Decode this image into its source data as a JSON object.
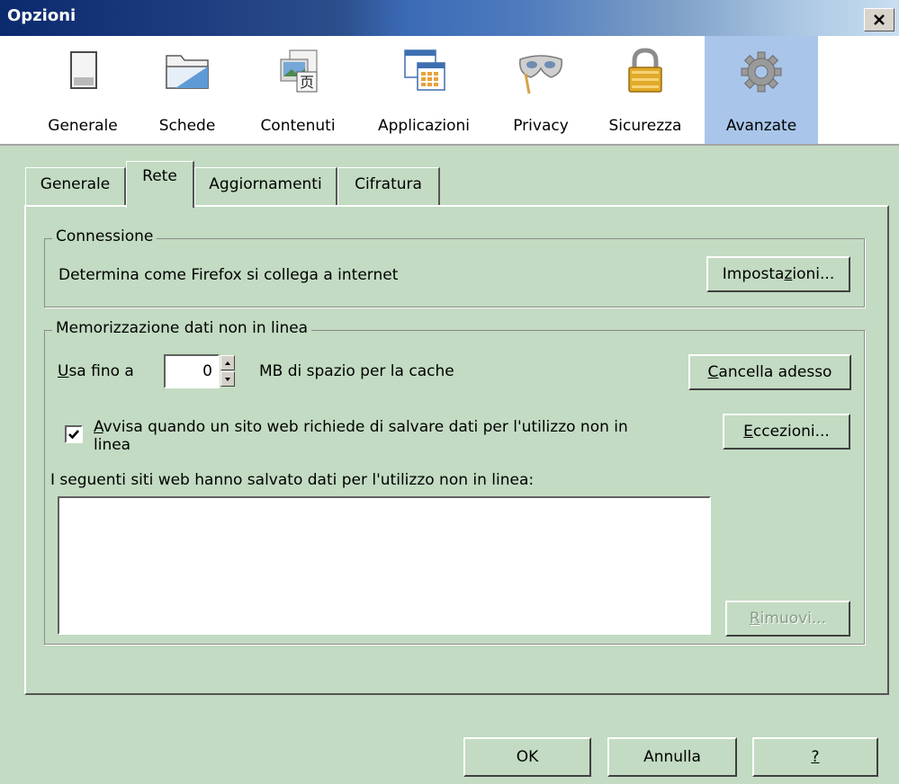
{
  "window": {
    "title": "Opzioni",
    "close_glyph": "✕"
  },
  "toolbar": {
    "items": [
      {
        "label": "Generale",
        "icon": "window-icon"
      },
      {
        "label": "Schede",
        "icon": "tabs-icon"
      },
      {
        "label": "Contenuti",
        "icon": "content-icon"
      },
      {
        "label": "Applicazioni",
        "icon": "applications-icon"
      },
      {
        "label": "Privacy",
        "icon": "privacy-mask-icon"
      },
      {
        "label": "Sicurezza",
        "icon": "lock-icon"
      },
      {
        "label": "Avanzate",
        "icon": "gear-icon"
      }
    ],
    "active_index": 6
  },
  "tabs": [
    {
      "label": "Generale"
    },
    {
      "label": "Rete"
    },
    {
      "label": "Aggiornamenti"
    },
    {
      "label": "Cifratura"
    }
  ],
  "active_tab": "Rete",
  "connection": {
    "title": "Connessione",
    "description": "Determina come Firefox si collega a internet",
    "settings_button": {
      "before": "Imposta",
      "mnemonic": "z",
      "after": "ioni..."
    }
  },
  "offline": {
    "title": "Memorizzazione dati non in linea",
    "use_up_to": {
      "mnemonic": "U",
      "rest": "sa fino a"
    },
    "cache_value": "0",
    "cache_unit_label": "MB di spazio per la cache",
    "clear_button": {
      "mnemonic": "C",
      "rest": "ancella adesso"
    },
    "notify_checkbox": {
      "checked": true,
      "mnemonic": "A",
      "line1_rest": "vvisa quando un sito web richiede di salvare dati per l'utilizzo non in",
      "line2": "linea"
    },
    "exceptions_button": {
      "mnemonic": "E",
      "rest": "ccezioni..."
    },
    "sites_label": "I seguenti siti web hanno salvato dati per l'utilizzo non in linea:",
    "remove_button": {
      "mnemonic": "R",
      "rest": "imuovi..."
    }
  },
  "footer": {
    "ok_label": "OK",
    "cancel_label": "Annulla",
    "help_label": "?"
  },
  "colors": {
    "dialog_bg": "#c2dbc2",
    "active_toolbar_bg": "#a9c6ea",
    "title_bar": "#0b2a6e"
  }
}
